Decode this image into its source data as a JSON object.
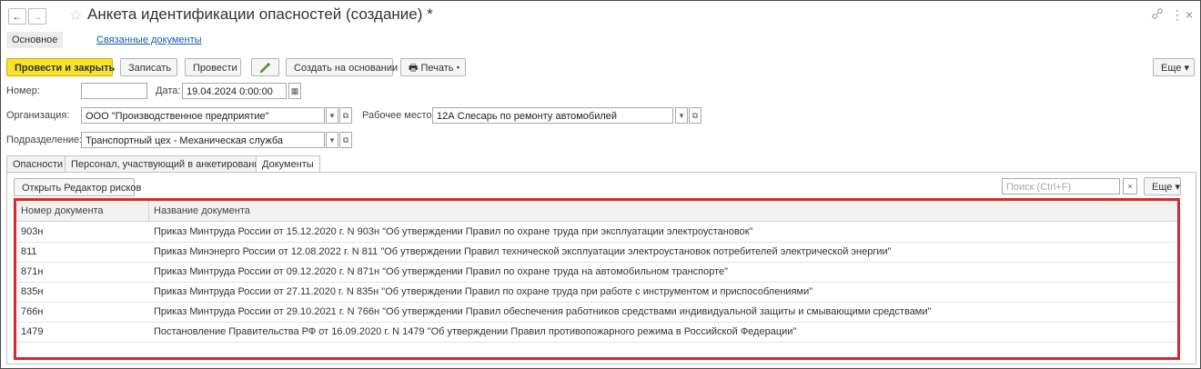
{
  "window": {
    "title": "Анкета идентификации опасностей (создание) *",
    "back": "←",
    "forward": "→",
    "star": "☆",
    "link_icon": "🔗",
    "more_icon": "⋮",
    "close_icon": "×"
  },
  "top_tabs": {
    "main": "Основное",
    "related": "Связанные документы"
  },
  "toolbar": {
    "post_close": "Провести и закрыть",
    "save": "Записать",
    "post": "Провести",
    "create_based": "Создать на основании ▾",
    "print": "Печать ▾",
    "more": "Еще ▾"
  },
  "form": {
    "number_label": "Номер:",
    "number_value": "",
    "date_label": "Дата:",
    "date_value": "19.04.2024  0:00:00",
    "org_label": "Организация:",
    "org_value": "ООО \"Производственное предприятие\"",
    "workplace_label": "Рабочее место:",
    "workplace_value": "12А Слесарь по ремонту автомобилей",
    "division_label": "Подразделение:",
    "division_value": "Транспортный цех - Механическая служба"
  },
  "inner_tabs": {
    "hazards": "Опасности",
    "personnel": "Персонал, участвующий в анкетировании",
    "documents": "Документы"
  },
  "docs_panel": {
    "open_editor": "Открыть Редактор рисков",
    "search_placeholder": "Поиск (Ctrl+F)",
    "more": "Еще ▾",
    "clear": "×"
  },
  "table": {
    "columns": [
      "Номер документа",
      "Название документа"
    ],
    "rows": [
      {
        "num": "903н",
        "name": "Приказ Минтруда России от 15.12.2020 г. N 903н \"Об утверждении Правил по охране труда при эксплуатации электроустановок\""
      },
      {
        "num": "811",
        "name": "Приказ Минэнерго России от 12.08.2022 г. N 811 \"Об утверждении Правил технической эксплуатации электроустановок потребителей электрической энергии\""
      },
      {
        "num": "871н",
        "name": "Приказ Минтруда России от 09.12.2020 г. N 871н \"Об утверждении Правил по охране труда на автомобильном транспорте\""
      },
      {
        "num": "835н",
        "name": "Приказ Минтруда России от 27.11.2020 г. N 835н \"Об утверждении Правил по охране труда при работе с инструментом и приспособлениями\""
      },
      {
        "num": "766н",
        "name": "Приказ Минтруда России от 29.10.2021 г. N 766н \"Об утверждении Правил обеспечения работников средствами индивидуальной защиты и смывающими средствами\""
      },
      {
        "num": "1479",
        "name": "Постановление Правительства РФ от 16.09.2020 г. N 1479 \"Об утверждении Правил противопожарного режима в Российской Федерации\""
      }
    ]
  }
}
